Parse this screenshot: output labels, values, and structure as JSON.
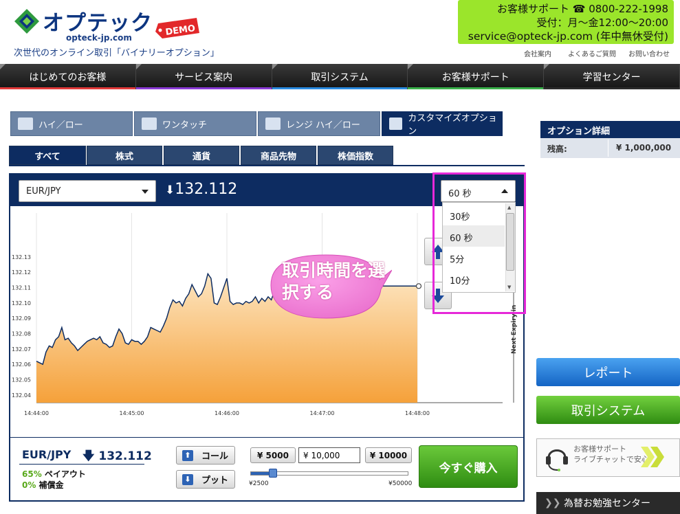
{
  "header": {
    "logo_text": "オプテック",
    "logo_domain": "opteck-jp.com",
    "demo_tag": "DEMO",
    "tagline": "次世代のオンライン取引「バイナリーオプション」",
    "support": {
      "line1": "お客様サポート ☎ 0800-222-1998",
      "line2": "受付：月～金12:00～20:00",
      "line3": "service@opteck-jp.com (年中無休受付)"
    },
    "util_links": [
      "会社案内",
      "よくあるご質問",
      "お問い合わせ"
    ]
  },
  "main_nav": {
    "items": [
      {
        "label": "はじめてのお客様",
        "color": "#e23a3a"
      },
      {
        "label": "サービス案内",
        "color": "#8a3ad6"
      },
      {
        "label": "取引システム",
        "color": "#2a8ae0"
      },
      {
        "label": "お客様サポート",
        "color": "#3ab04a"
      },
      {
        "label": "学習センター",
        "color": "#2a2a2a"
      }
    ]
  },
  "product_tabs": {
    "items": [
      {
        "label": "ハイ／ロー",
        "active": false
      },
      {
        "label": "ワンタッチ",
        "active": false
      },
      {
        "label": "レンジ ハイ／ロー",
        "active": false
      },
      {
        "label": "カスタマイズオプション",
        "active": true
      }
    ]
  },
  "category_tabs": {
    "items": [
      {
        "label": "すべて",
        "active": true
      },
      {
        "label": "株式",
        "active": false
      },
      {
        "label": "通貨",
        "active": false
      },
      {
        "label": "商品先物",
        "active": false
      },
      {
        "label": "株価指数",
        "active": false
      }
    ]
  },
  "trade": {
    "pair": "EUR/JPY",
    "price_arrow": "🡇",
    "price": "132.112",
    "time_selected": "60 秒",
    "time_options": [
      "30秒",
      "60 秒",
      "5分",
      "10分"
    ],
    "callout": "取引時間を選択する",
    "expiry_label": "Next Expiry in"
  },
  "chart_data": {
    "type": "area",
    "xlabel": "",
    "ylabel": "",
    "x_ticks": [
      "14:44:00",
      "14:45:00",
      "14:46:00",
      "14:47:00",
      "14:48:00"
    ],
    "y_ticks": [
      "132.13",
      "132.12",
      "132.11",
      "132.10",
      "132.09",
      "132.08",
      "132.07",
      "132.06",
      "132.05",
      "132.04"
    ],
    "ylim": [
      132.035,
      132.138
    ],
    "x": [
      0,
      2,
      4,
      6,
      8,
      10,
      12,
      14,
      16,
      18,
      20,
      22,
      24,
      26,
      28,
      30,
      32,
      34,
      36,
      38,
      40,
      42,
      44,
      46,
      48,
      50,
      52,
      54,
      56,
      58,
      60,
      62,
      64,
      66,
      68,
      70,
      72,
      74,
      76,
      78,
      80,
      82,
      84,
      86,
      88,
      90,
      92,
      94,
      96,
      98,
      100,
      102,
      104,
      106,
      108,
      110,
      112,
      114,
      116,
      118,
      120,
      122,
      124,
      126,
      128,
      130,
      132,
      134,
      136,
      138,
      140,
      142,
      144,
      146,
      148,
      150,
      152,
      154,
      156,
      158,
      160,
      162,
      164,
      166,
      168,
      170,
      172,
      174,
      176,
      178,
      180,
      182,
      184,
      186,
      188,
      190,
      192,
      194,
      196,
      198,
      200,
      202,
      204,
      206,
      208,
      210,
      212,
      214,
      216,
      218,
      220,
      222,
      224,
      226,
      228,
      230,
      232,
      234,
      236,
      238,
      240
    ],
    "y": [
      132.062,
      132.061,
      132.06,
      132.068,
      132.072,
      132.071,
      132.076,
      132.078,
      132.084,
      132.076,
      132.077,
      132.074,
      132.072,
      132.069,
      132.071,
      132.073,
      132.075,
      132.076,
      132.077,
      132.076,
      132.078,
      132.074,
      132.073,
      132.071,
      132.072,
      132.078,
      132.083,
      132.08,
      132.074,
      132.073,
      132.076,
      132.075,
      132.075,
      132.073,
      132.075,
      132.078,
      132.084,
      132.083,
      132.082,
      132.081,
      132.085,
      132.09,
      132.097,
      132.102,
      132.1,
      132.101,
      132.098,
      132.103,
      132.106,
      132.112,
      132.108,
      132.104,
      132.106,
      132.111,
      132.119,
      132.116,
      132.1,
      132.099,
      132.104,
      132.11,
      132.116,
      132.101,
      132.099,
      132.1,
      132.1,
      132.099,
      132.101,
      132.1,
      132.101,
      132.104,
      132.1,
      132.103,
      132.101,
      132.104,
      132.102,
      132.108,
      132.104,
      132.103,
      132.111,
      132.108,
      132.103,
      132.108,
      132.106,
      132.109,
      132.111,
      132.111,
      132.111,
      132.111,
      132.111,
      132.111,
      132.111,
      132.111,
      132.111,
      132.111,
      132.111,
      132.111,
      132.111,
      132.111,
      132.111,
      132.111,
      132.111,
      132.111,
      132.111,
      132.111,
      132.111,
      132.111,
      132.111,
      132.111,
      132.111,
      132.111,
      132.111,
      132.111,
      132.111,
      132.111,
      132.111,
      132.111,
      132.111,
      132.111,
      132.111,
      132.111,
      132.111
    ]
  },
  "bottom": {
    "pair": "EUR/JPY",
    "price": "🡇 132.112",
    "payout_pct": "65%",
    "payout_label": " ペイアウト",
    "insurance_pct": "0%",
    "insurance_label": " 補償金",
    "call_label": "コール",
    "put_label": "プット",
    "amt_low": "¥ 5000",
    "amt_value": "¥ 10,000",
    "amt_high": "¥ 10000",
    "slider_min": "¥2500",
    "slider_max": "¥50000",
    "slider_value_fraction": 0.13,
    "buy_label": "今すぐ購入"
  },
  "sidebar": {
    "detail_title": "オプション詳細",
    "balance_label": "残高:",
    "balance_value": "¥ 1,000,000",
    "report_label": "レポート",
    "system_label": "取引システム",
    "chat_line1": "お客様サポート",
    "chat_line2": "ライブチャットで安心！",
    "study_label": "為替お勉強センター"
  }
}
